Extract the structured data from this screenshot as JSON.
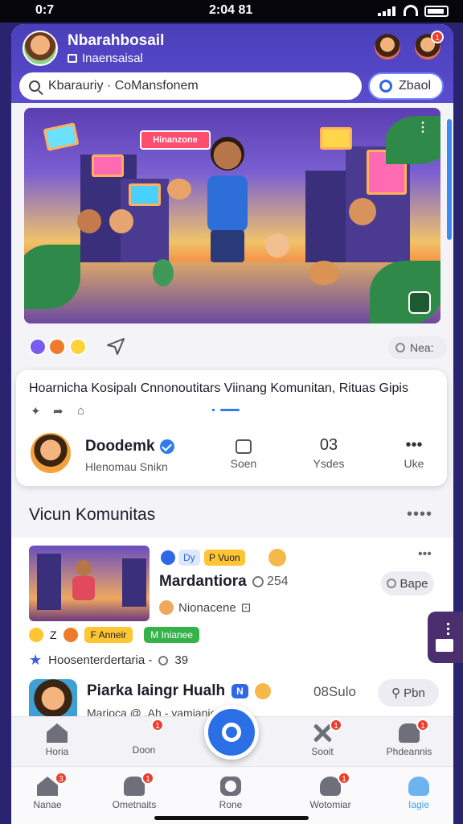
{
  "status": {
    "left": "0:7",
    "center": "2:04 81"
  },
  "header": {
    "title": "Nbarahbosail",
    "subtitle": "Inaensaisal",
    "search_placeholder": "Kbarauriy · CoMansfonem",
    "pill_label": "Zbaol"
  },
  "hero": {
    "banner": "Hinanzone"
  },
  "actions": {
    "next_label": "Nea:"
  },
  "post": {
    "caption": "Hoarnicha Kosipalı Cnnonoutitars Viinang Komunitan, Rituas Gipis",
    "author_name": "Doodemk",
    "author_handle": "Hlenomau Snikn",
    "stats": [
      {
        "top": "",
        "label": "Soen"
      },
      {
        "top": "03",
        "label": "Ysdes"
      },
      {
        "top": "•••",
        "label": "Uke"
      }
    ]
  },
  "section": {
    "title": "Vicun Komunitas",
    "more": "••••"
  },
  "list": {
    "item1": {
      "chip_a": "Dy",
      "chip_b": "P Vuon",
      "title": "Mardantiora",
      "count": "254",
      "subtitle": "Nionacene",
      "action": "Bape",
      "tag_a": "Z",
      "tag_b": "F Anneir",
      "tag_c": "M Inianee",
      "rating_label": "Hoosenterdertaria -",
      "rating_value": "39"
    },
    "item2": {
      "title": "Piarka laingr Hualh",
      "tag": "N",
      "subtitle": "Marioca @ .Ah - yamianie",
      "count": "08Sulo",
      "action": "Pbn"
    }
  },
  "nav_top": [
    {
      "label": "Horia"
    },
    {
      "label": "Doon"
    },
    {
      "label": "Sooit"
    },
    {
      "label": "Phdeannis"
    }
  ],
  "nav_bottom": [
    {
      "label": "Nanae"
    },
    {
      "label": "Ometnaits"
    },
    {
      "label": "Rone"
    },
    {
      "label": "Wotomiar"
    },
    {
      "label": "Iagie"
    }
  ],
  "badges": {
    "hdr": "1",
    "nav_top_doon": "1",
    "nav_top_sooit": "1",
    "nav_top_ph": "1",
    "nav_b_nanae": "3",
    "nav_b_omet": "1",
    "nav_b_woto": "1"
  },
  "colors": {
    "header": "#4a3fbb",
    "accent": "#2a6fe6",
    "page_bg": "#2a2470"
  }
}
